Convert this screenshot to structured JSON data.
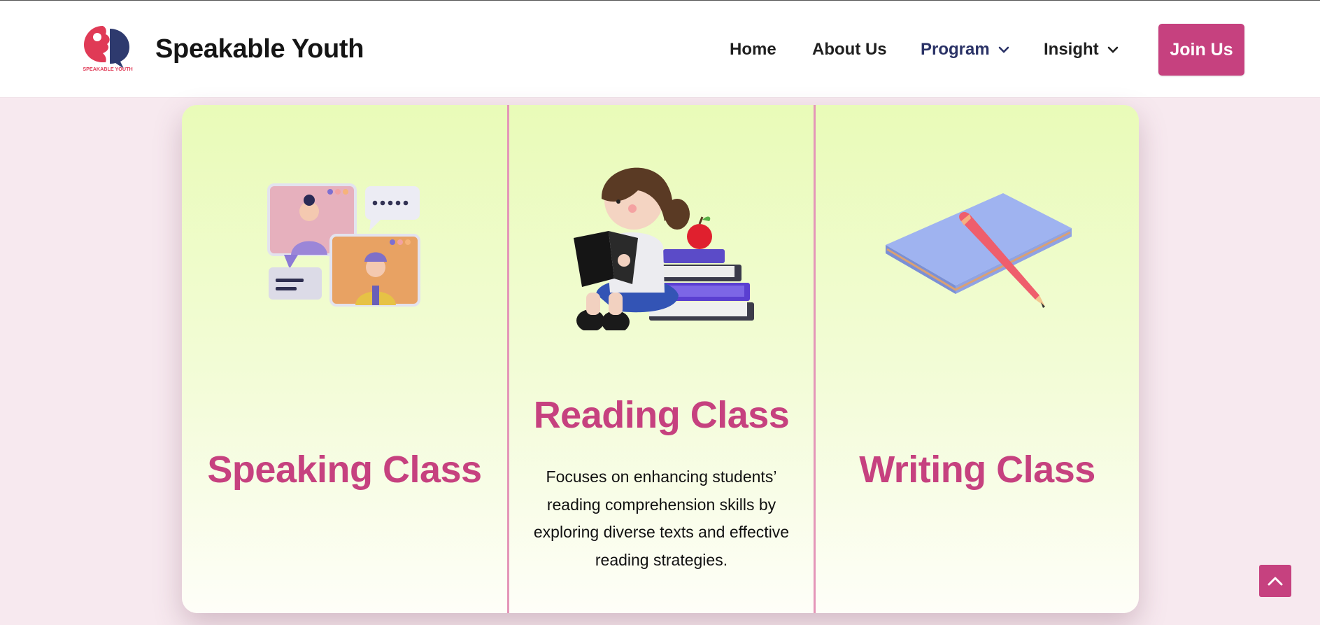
{
  "brand": {
    "name": "Speakable Youth",
    "logo_text": "SPEAKABLE YOUTH"
  },
  "nav": {
    "items": [
      {
        "label": "Home"
      },
      {
        "label": "About Us"
      },
      {
        "label": "Program"
      },
      {
        "label": "Insight"
      }
    ],
    "cta_label": "Join Us"
  },
  "cards": [
    {
      "title": "Speaking Class",
      "description": ""
    },
    {
      "title": "Reading Class",
      "description": "Focuses on enhancing students’ reading comprehension skills by exploring diverse texts and effective reading strategies."
    },
    {
      "title": "Writing Class",
      "description": ""
    }
  ],
  "colors": {
    "accent": "#c6417f",
    "nav_active": "#2a3266",
    "page_bg": "#f7e9ef",
    "card_top": "#e9fbb8"
  },
  "icons": {
    "dropdown": "chevron-down-icon",
    "scroll_top": "chevron-up-icon"
  }
}
